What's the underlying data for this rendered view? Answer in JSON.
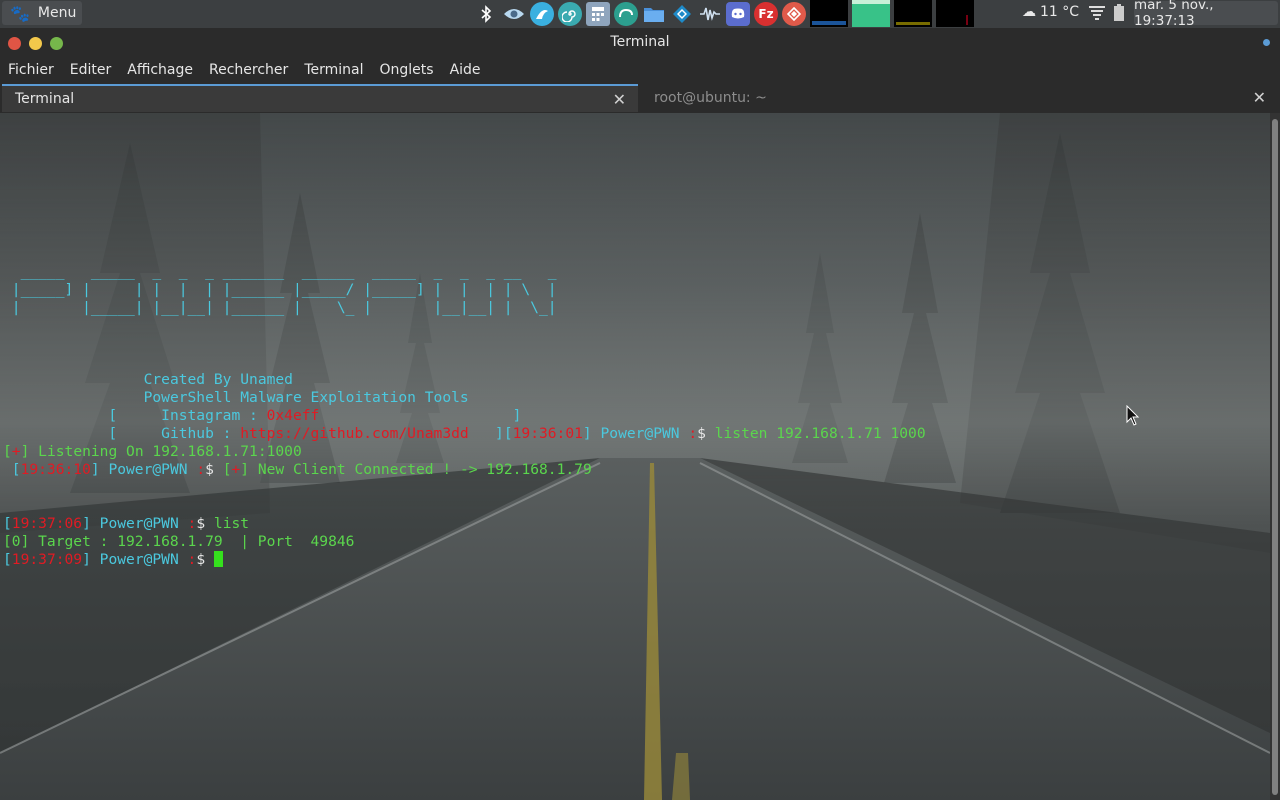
{
  "panel": {
    "menu_label": "Menu",
    "tray_icons": [
      "bluetooth-icon",
      "eye-icon",
      "shark-icon",
      "spiral-icon",
      "calculator-icon",
      "mastodon-icon",
      "folder-icon",
      "kodi-icon",
      "audio-wave-icon",
      "discord-icon",
      "filezilla-icon",
      "anydesk-icon"
    ],
    "weather": "11 °C",
    "clock": "mar.  5 nov., 19:37:13"
  },
  "window": {
    "title": "Terminal"
  },
  "menubar": [
    "Fichier",
    "Editer",
    "Affichage",
    "Rechercher",
    "Terminal",
    "Onglets",
    "Aide"
  ],
  "tabs": [
    {
      "label": "Terminal",
      "active": true
    },
    {
      "label": "root@ubuntu: ~",
      "active": false
    }
  ],
  "terminal": {
    "banner": [
      "  _____   _____  _  _  _ _______  ______  _____  _  _  _ __   _",
      " |_____] |     | |  |  | |______ |_____/ |_____] |  |  | | \\  |",
      " |       |_____| |__|__| |______ |    \\_ |       |__|__| |  \\_|"
    ],
    "credits": {
      "created_by": "Created By Unamed",
      "subtitle": "PowerShell Malware Exploitation Tools",
      "instagram_label": "Instagram : ",
      "instagram_value": "0x4eff",
      "github_label": "Github : ",
      "github_value": "https://github.com/Unam3dd"
    },
    "prompt": "Power@PWN",
    "session": [
      {
        "time": "19:36:01",
        "command": "listen 192.168.1.71 1000"
      },
      {
        "status_prefix": "+",
        "status_text": "Listening On 192.168.1.71:1000"
      },
      {
        "time": "19:36:10",
        "event_prefix": "+",
        "event_text": "New Client Connected ! -> 192.168.1.79"
      },
      {
        "time": "19:37:06",
        "command": "list"
      },
      {
        "output": "[0] Target : 192.168.1.79  | Port  49846"
      },
      {
        "time": "19:37:09",
        "command": ""
      }
    ]
  },
  "colors": {
    "cyan": "#4bc9df",
    "red": "#e01b24",
    "green": "#5bd64d",
    "cursor": "#35e01d",
    "accent": "#5b9bd5"
  }
}
